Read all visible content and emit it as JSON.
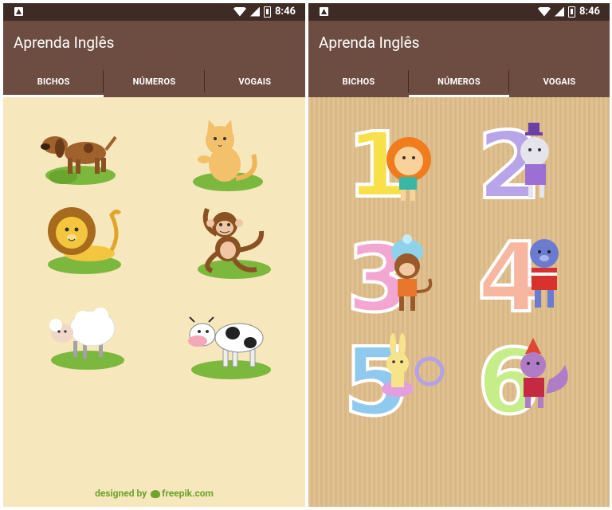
{
  "status": {
    "time": "8:46"
  },
  "app": {
    "title": "Aprenda Inglês"
  },
  "tabs": [
    {
      "label": "BICHOS"
    },
    {
      "label": "NÚMEROS"
    },
    {
      "label": "VOGAIS"
    }
  ],
  "left": {
    "active_tab": "BICHOS",
    "animals": [
      "dog",
      "cat",
      "lion",
      "monkey",
      "sheep",
      "cow"
    ],
    "credit": "designed by",
    "credit_brand": "freepik.com"
  },
  "right": {
    "active_tab": "NÚMEROS",
    "numbers": [
      "1",
      "2",
      "3",
      "4",
      "5",
      "6"
    ]
  },
  "colors": {
    "status_bar": "#3e2b26",
    "app_bar": "#6d4c41",
    "animals_bg": "#f7e7bd",
    "numbers_bg": "#dfbe8a"
  }
}
